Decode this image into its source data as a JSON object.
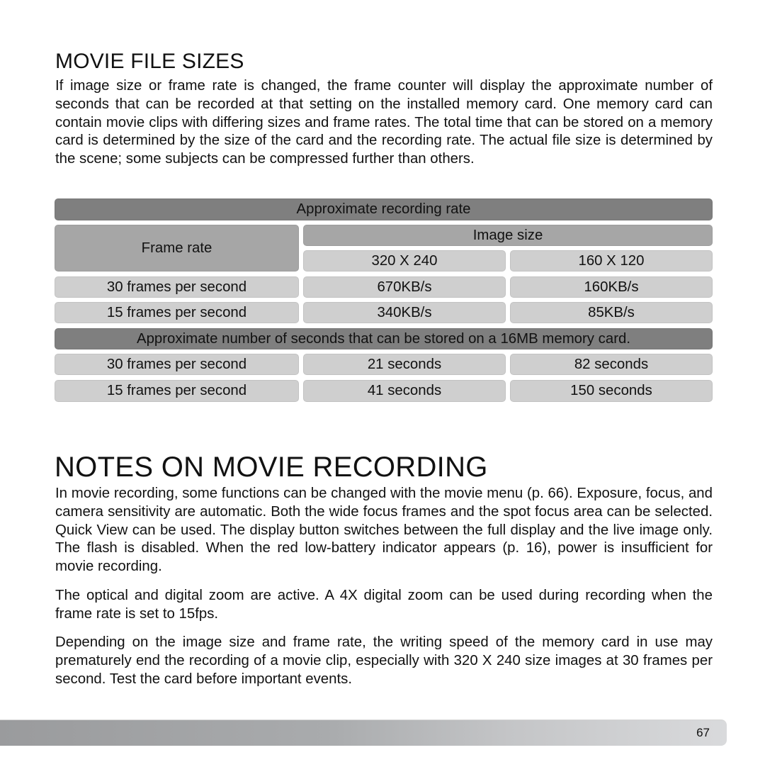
{
  "section1": {
    "title": "MOVIE FILE SIZES",
    "paragraph": "If image size or frame rate is changed, the frame counter will display the approximate number of seconds that can be recorded at that setting on the installed memory card. One memory card can contain movie clips with differing sizes and frame rates. The total time that can be stored on a memory card is determined by the size of the card and the recording rate. The actual file size is determined by the scene; some subjects can be compressed further than others."
  },
  "table": {
    "rate_header": "Approximate recording rate",
    "frame_rate_label": "Frame rate",
    "image_size_label": "Image size",
    "sizes": [
      "320 X 240",
      "160 X 120"
    ],
    "rate_rows": [
      {
        "frame_rate": "30 frames per second",
        "values": [
          "670KB/s",
          "160KB/s"
        ]
      },
      {
        "frame_rate": "15 frames per second",
        "values": [
          "340KB/s",
          "85KB/s"
        ]
      }
    ],
    "seconds_header": "Approximate number of seconds that can be stored on a 16MB memory card.",
    "seconds_rows": [
      {
        "frame_rate": "30 frames per second",
        "values": [
          "21 seconds",
          "82 seconds"
        ]
      },
      {
        "frame_rate": "15 frames per second",
        "values": [
          "41 seconds",
          "150 seconds"
        ]
      }
    ]
  },
  "section2": {
    "title": "NOTES ON MOVIE RECORDING",
    "paragraphs": [
      "In movie recording, some functions can be changed with the movie menu (p. 66). Exposure, focus, and camera sensitivity are automatic. Both the wide focus frames and the spot focus area can be selected. Quick View can be used. The display button switches between the full display and the live image only. The flash is disabled. When the red low-battery indicator appears (p. 16), power is insufficient for movie recording.",
      "The optical and digital zoom are active. A 4X digital zoom can be used during recording when the frame rate is set to 15fps.",
      "Depending on the image size and frame rate, the writing speed of the memory card in use may prematurely end the recording of a movie clip, especially with 320 X 240 size images at 30 frames per second. Test the card before important events."
    ]
  },
  "footer": {
    "page_number": "67"
  }
}
